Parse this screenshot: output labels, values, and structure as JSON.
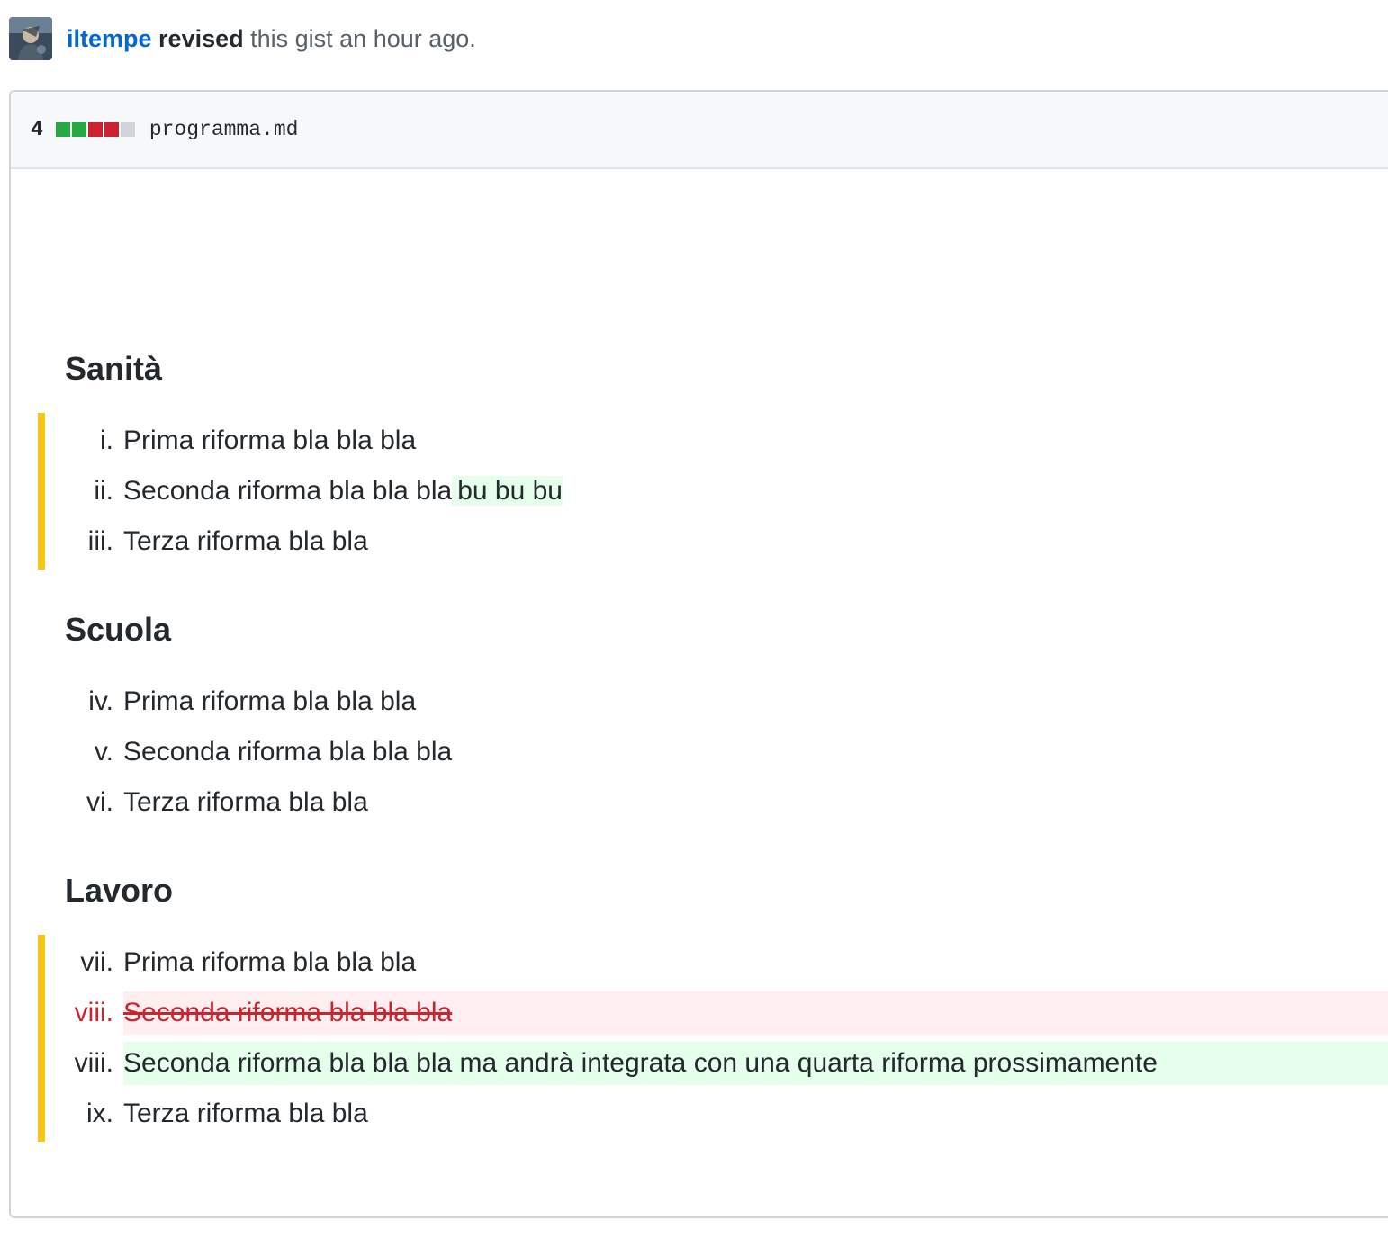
{
  "revision": {
    "username": "iltempe",
    "action": "revised",
    "rest": " this gist an hour ago."
  },
  "file": {
    "change_count": "4",
    "diffstat_colors": [
      "#28a745",
      "#28a745",
      "#cb2431",
      "#cb2431",
      "#d1d5da"
    ],
    "name": "programma.md"
  },
  "sections": [
    {
      "heading": "Sanità",
      "changed": true,
      "items": [
        {
          "marker": "i.",
          "text": "Prima riforma bla bla bla",
          "status": "unchanged"
        },
        {
          "marker": "ii.",
          "text": "Seconda riforma bla bla bla",
          "added_inline": "bu bu bu",
          "status": "modified"
        },
        {
          "marker": "iii.",
          "text": "Terza riforma bla bla",
          "status": "unchanged"
        }
      ]
    },
    {
      "heading": "Scuola",
      "changed": false,
      "items": [
        {
          "marker": "iv.",
          "text": "Prima riforma bla bla bla",
          "status": "unchanged"
        },
        {
          "marker": "v.",
          "text": "Seconda riforma bla bla bla",
          "status": "unchanged"
        },
        {
          "marker": "vi.",
          "text": "Terza riforma bla bla",
          "status": "unchanged"
        }
      ]
    },
    {
      "heading": "Lavoro",
      "changed": true,
      "items": [
        {
          "marker": "vii.",
          "text": "Prima riforma bla bla bla",
          "status": "unchanged"
        },
        {
          "marker": "viii.",
          "text": "Seconda riforma bla bla bla",
          "status": "deleted"
        },
        {
          "marker": "viii.",
          "text": "Seconda riforma bla bla bla ma andrà integrata con una quarta riforma prossimamente",
          "status": "added"
        },
        {
          "marker": "ix.",
          "text": "Terza riforma bla bla",
          "status": "unchanged"
        }
      ]
    }
  ],
  "colors": {
    "link": "#0366d6",
    "change_bar": "#f9c513",
    "added_bg": "#e6ffed",
    "deleted_bg": "#ffeef0",
    "deleted_text": "#cb2431"
  }
}
